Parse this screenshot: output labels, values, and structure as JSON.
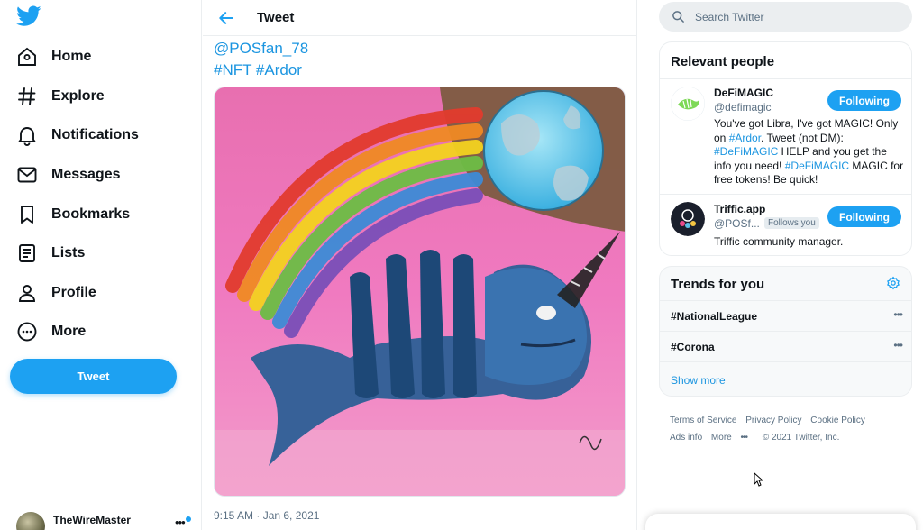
{
  "sidebar": {
    "nav": [
      {
        "label": "Home",
        "icon": "home-icon"
      },
      {
        "label": "Explore",
        "icon": "hashtag-icon"
      },
      {
        "label": "Notifications",
        "icon": "bell-icon"
      },
      {
        "label": "Messages",
        "icon": "envelope-icon"
      },
      {
        "label": "Bookmarks",
        "icon": "bookmark-icon"
      },
      {
        "label": "Lists",
        "icon": "list-icon"
      },
      {
        "label": "Profile",
        "icon": "person-icon"
      },
      {
        "label": "More",
        "icon": "more-circle-icon"
      }
    ],
    "tweet_button": "Tweet",
    "account_name": "TheWireMaster"
  },
  "main": {
    "title": "Tweet",
    "tweet_line1": "@POSfan_78",
    "tweet_line2": "#NFT #Ardor",
    "timestamp": "9:15 AM · Jan 6, 2021"
  },
  "right": {
    "search_placeholder": "Search Twitter",
    "relevant_title": "Relevant people",
    "people": [
      {
        "name": "DeFiMAGIC",
        "handle": "@defimagic",
        "button": "Following",
        "bio_parts": [
          "You've got Libra, I've got MAGIC! Only on ",
          "#Ardor",
          ". Tweet (not DM): ",
          "#DeFiMAGIC",
          " HELP and you get the info you need! ",
          "#DeFiMAGIC",
          " MAGIC for free tokens! Be quick!"
        ]
      },
      {
        "name": "Triffic.app",
        "handle": "@POSf...",
        "follows_you": "Follows you",
        "button": "Following",
        "bio": "Triffic community manager."
      }
    ],
    "trends_title": "Trends for you",
    "trends": [
      {
        "name": "#NationalLeague"
      },
      {
        "name": "#Corona"
      }
    ],
    "show_more": "Show more",
    "footer": {
      "terms": "Terms of Service",
      "privacy": "Privacy Policy",
      "cookie": "Cookie Policy",
      "ads": "Ads info",
      "more": "More",
      "copyright": "© 2021 Twitter, Inc."
    }
  },
  "colors": {
    "accent": "#1da1f2",
    "link": "#1b95e0",
    "muted": "#5b7083",
    "border": "#ebeef0"
  }
}
